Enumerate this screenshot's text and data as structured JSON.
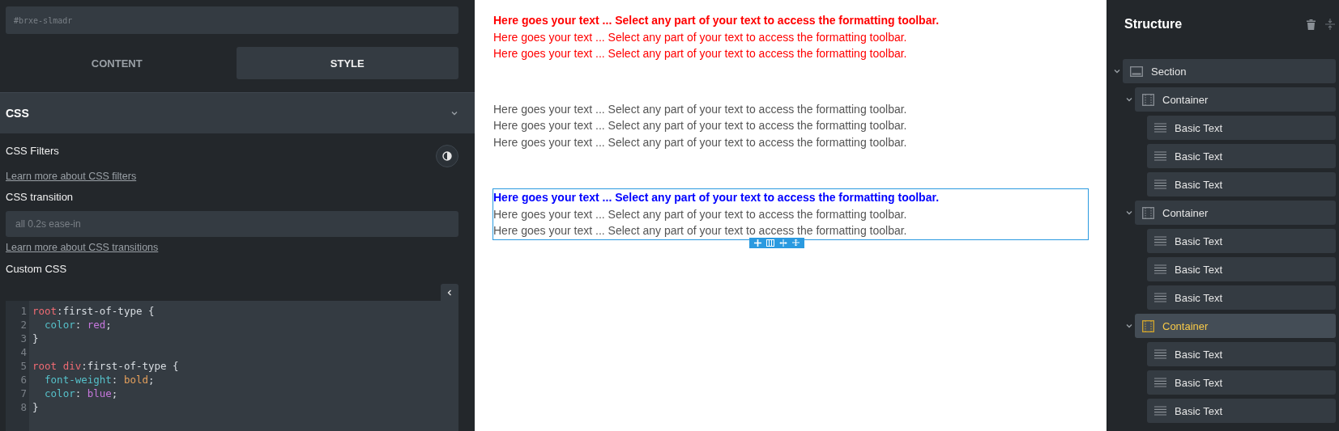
{
  "inspector": {
    "id_field": {
      "placeholder": "#brxe-slmadr"
    },
    "tabs": [
      {
        "label": "CONTENT",
        "selected": false
      },
      {
        "label": "STYLE",
        "selected": true
      }
    ],
    "section": {
      "title": "CSS",
      "expanded": true
    },
    "filters_label": "CSS Filters",
    "filters_link": "Learn more about CSS filters",
    "transition_label": "CSS transition",
    "transition_field": {
      "placeholder": "all 0.2s ease-in"
    },
    "transition_link": "Learn more about CSS transitions",
    "custom_css_label": "Custom CSS",
    "code": [
      {
        "number": "1",
        "tokens": [
          {
            "text": "root",
            "kind": "selector"
          },
          {
            "text": ":first-of-type {",
            "kind": "plain"
          }
        ]
      },
      {
        "number": "2",
        "tokens": [
          {
            "text": "  color",
            "kind": "property"
          },
          {
            "text": ": ",
            "kind": "plain"
          },
          {
            "text": "red",
            "kind": "keyword"
          },
          {
            "text": ";",
            "kind": "plain"
          }
        ]
      },
      {
        "number": "3",
        "tokens": [
          {
            "text": "}",
            "kind": "plain"
          }
        ]
      },
      {
        "number": "4"
      },
      {
        "number": "5",
        "tokens": [
          {
            "text": "root div",
            "kind": "selector"
          },
          {
            "text": ":first-of-type {",
            "kind": "plain"
          }
        ]
      },
      {
        "number": "6",
        "tokens": [
          {
            "text": "  font-weight",
            "kind": "property"
          },
          {
            "text": ": ",
            "kind": "plain"
          },
          {
            "text": "bold",
            "kind": "number"
          },
          {
            "text": ";",
            "kind": "plain"
          }
        ]
      },
      {
        "number": "7",
        "tokens": [
          {
            "text": "  color",
            "kind": "property"
          },
          {
            "text": ": ",
            "kind": "plain"
          },
          {
            "text": "blue",
            "kind": "keyword"
          },
          {
            "text": ";",
            "kind": "plain"
          }
        ]
      },
      {
        "number": "8",
        "tokens": [
          {
            "text": "}",
            "kind": "plain"
          }
        ]
      }
    ]
  },
  "canvas": {
    "containers": [
      {
        "selected": false,
        "lines": [
          {
            "text": "Here goes your text ... Select any part of your text to access the formatting toolbar.",
            "bold": true,
            "color": "#ff0000"
          },
          {
            "text": "Here goes your text ... Select any part of your text to access the formatting toolbar.",
            "bold": false,
            "color": "#ff0000"
          },
          {
            "text": "Here goes your text ... Select any part of your text to access the formatting toolbar.",
            "bold": false,
            "color": "#ff0000"
          }
        ]
      },
      {
        "selected": false,
        "lines": [
          {
            "text": "Here goes your text ... Select any part of your text to access the formatting toolbar.",
            "bold": false,
            "color": "#555555"
          },
          {
            "text": "Here goes your text ... Select any part of your text to access the formatting toolbar.",
            "bold": false,
            "color": "#555555"
          },
          {
            "text": "Here goes your text ... Select any part of your text to access the formatting toolbar.",
            "bold": false,
            "color": "#555555"
          }
        ]
      },
      {
        "selected": true,
        "lines": [
          {
            "text": "Here goes your text ... Select any part of your text to access the formatting toolbar.",
            "bold": true,
            "color": "#0000ff"
          },
          {
            "text": "Here goes your text ... Select any part of your text to access the formatting toolbar.",
            "bold": false,
            "color": "#555555"
          },
          {
            "text": "Here goes your text ... Select any part of your text to access the formatting toolbar.",
            "bold": false,
            "color": "#555555"
          }
        ]
      }
    ]
  },
  "structure": {
    "title": "Structure",
    "tree": [
      {
        "label": "Section",
        "kind": "section",
        "expanded": true,
        "selected": false,
        "children": [
          {
            "label": "Container",
            "kind": "container",
            "expanded": true,
            "selected": false,
            "children": [
              {
                "label": "Basic Text",
                "kind": "text",
                "selected": false
              },
              {
                "label": "Basic Text",
                "kind": "text",
                "selected": false
              },
              {
                "label": "Basic Text",
                "kind": "text",
                "selected": false
              }
            ]
          },
          {
            "label": "Container",
            "kind": "container",
            "expanded": true,
            "selected": false,
            "children": [
              {
                "label": "Basic Text",
                "kind": "text",
                "selected": false
              },
              {
                "label": "Basic Text",
                "kind": "text",
                "selected": false
              },
              {
                "label": "Basic Text",
                "kind": "text",
                "selected": false
              }
            ]
          },
          {
            "label": "Container",
            "kind": "container",
            "expanded": true,
            "selected": true,
            "children": [
              {
                "label": "Basic Text",
                "kind": "text",
                "selected": false
              },
              {
                "label": "Basic Text",
                "kind": "text",
                "selected": false
              },
              {
                "label": "Basic Text",
                "kind": "text",
                "selected": false
              }
            ]
          }
        ]
      }
    ]
  }
}
